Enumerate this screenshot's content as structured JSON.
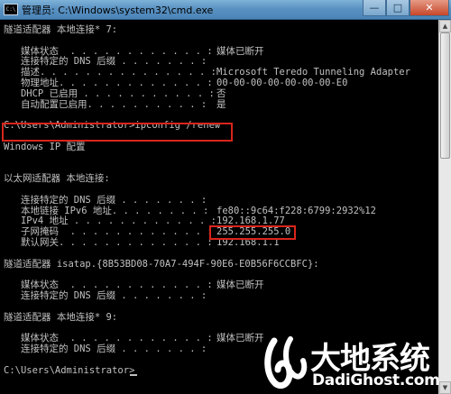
{
  "window": {
    "title": "管理员: C:\\Windows\\system32\\cmd.exe",
    "icon_label": "C:\\",
    "minimize_glyph": "—",
    "maximize_glyph": "□",
    "close_glyph": "✕"
  },
  "console": {
    "lines": [
      "隧道适配器 本地连接* 7:",
      "",
      "   媒体状态  . . . . . . . . . . . . : 媒体已断开",
      "   连接特定的 DNS 后缀 . . . . . . . :",
      "   描述. . . . . . . . . . . . . . . : Microsoft Teredo Tunneling Adapter",
      "   物理地址. . . . . . . . . . . . . : 00-00-00-00-00-00-00-E0",
      "   DHCP 已启用 . . . . . . . . . . . : 否",
      "   自动配置已启用. . . . . . . . . . : 是",
      "",
      "C:\\Users\\Administrator>ipconfig /renew",
      "",
      "Windows IP 配置",
      "",
      "",
      "以太网适配器 本地连接:",
      "",
      "   连接特定的 DNS 后缀 . . . . . . . :",
      "   本地链接 IPv6 地址. . . . . . . . : fe80::9c64:f228:6799:2932%12",
      "   IPv4 地址 . . . . . . . . . . . . : 192.168.1.77",
      "   子网掩码  . . . . . . . . . . . . : 255.255.255.0",
      "   默认网关. . . . . . . . . . . . . : 192.168.1.1",
      "",
      "隧道适配器 isatap.{8B53BD08-70A7-494F-90E6-E0B56F6CCBFC}:",
      "",
      "   媒体状态  . . . . . . . . . . . . : 媒体已断开",
      "   连接特定的 DNS 后缀 . . . . . . . :",
      "",
      "隧道适配器 本地连接* 9:",
      "",
      "   媒体状态  . . . . . . . . . . . . : 媒体已断开",
      "   连接特定的 DNS 后缀 . . . . . . . :",
      "",
      "C:\\Users\\Administrator>"
    ]
  },
  "highlights": {
    "command": "ipconfig /renew",
    "ipv4_address": "192.168.1.77"
  },
  "watermark": {
    "brand_cn": "大地系统",
    "brand_url": "DadiGhost.com"
  },
  "colors": {
    "console_bg": "#000000",
    "console_text": "#c0c0c0",
    "highlight_border": "#d9251c",
    "titlebar": "#5a92c2"
  }
}
